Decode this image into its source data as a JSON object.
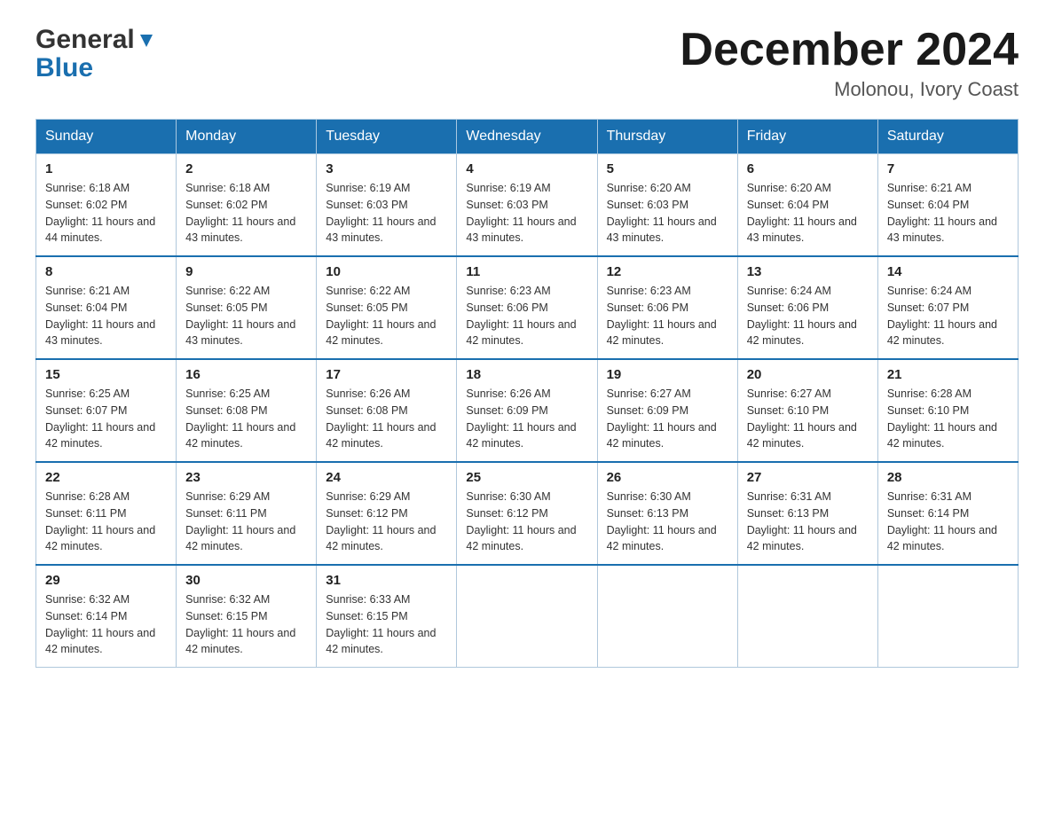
{
  "header": {
    "logo_line1": "General",
    "logo_line2": "Blue",
    "month_year": "December 2024",
    "location": "Molonou, Ivory Coast"
  },
  "days_of_week": [
    "Sunday",
    "Monday",
    "Tuesday",
    "Wednesday",
    "Thursday",
    "Friday",
    "Saturday"
  ],
  "weeks": [
    [
      {
        "day": "1",
        "sunrise": "6:18 AM",
        "sunset": "6:02 PM",
        "daylight": "11 hours and 44 minutes."
      },
      {
        "day": "2",
        "sunrise": "6:18 AM",
        "sunset": "6:02 PM",
        "daylight": "11 hours and 43 minutes."
      },
      {
        "day": "3",
        "sunrise": "6:19 AM",
        "sunset": "6:03 PM",
        "daylight": "11 hours and 43 minutes."
      },
      {
        "day": "4",
        "sunrise": "6:19 AM",
        "sunset": "6:03 PM",
        "daylight": "11 hours and 43 minutes."
      },
      {
        "day": "5",
        "sunrise": "6:20 AM",
        "sunset": "6:03 PM",
        "daylight": "11 hours and 43 minutes."
      },
      {
        "day": "6",
        "sunrise": "6:20 AM",
        "sunset": "6:04 PM",
        "daylight": "11 hours and 43 minutes."
      },
      {
        "day": "7",
        "sunrise": "6:21 AM",
        "sunset": "6:04 PM",
        "daylight": "11 hours and 43 minutes."
      }
    ],
    [
      {
        "day": "8",
        "sunrise": "6:21 AM",
        "sunset": "6:04 PM",
        "daylight": "11 hours and 43 minutes."
      },
      {
        "day": "9",
        "sunrise": "6:22 AM",
        "sunset": "6:05 PM",
        "daylight": "11 hours and 43 minutes."
      },
      {
        "day": "10",
        "sunrise": "6:22 AM",
        "sunset": "6:05 PM",
        "daylight": "11 hours and 42 minutes."
      },
      {
        "day": "11",
        "sunrise": "6:23 AM",
        "sunset": "6:06 PM",
        "daylight": "11 hours and 42 minutes."
      },
      {
        "day": "12",
        "sunrise": "6:23 AM",
        "sunset": "6:06 PM",
        "daylight": "11 hours and 42 minutes."
      },
      {
        "day": "13",
        "sunrise": "6:24 AM",
        "sunset": "6:06 PM",
        "daylight": "11 hours and 42 minutes."
      },
      {
        "day": "14",
        "sunrise": "6:24 AM",
        "sunset": "6:07 PM",
        "daylight": "11 hours and 42 minutes."
      }
    ],
    [
      {
        "day": "15",
        "sunrise": "6:25 AM",
        "sunset": "6:07 PM",
        "daylight": "11 hours and 42 minutes."
      },
      {
        "day": "16",
        "sunrise": "6:25 AM",
        "sunset": "6:08 PM",
        "daylight": "11 hours and 42 minutes."
      },
      {
        "day": "17",
        "sunrise": "6:26 AM",
        "sunset": "6:08 PM",
        "daylight": "11 hours and 42 minutes."
      },
      {
        "day": "18",
        "sunrise": "6:26 AM",
        "sunset": "6:09 PM",
        "daylight": "11 hours and 42 minutes."
      },
      {
        "day": "19",
        "sunrise": "6:27 AM",
        "sunset": "6:09 PM",
        "daylight": "11 hours and 42 minutes."
      },
      {
        "day": "20",
        "sunrise": "6:27 AM",
        "sunset": "6:10 PM",
        "daylight": "11 hours and 42 minutes."
      },
      {
        "day": "21",
        "sunrise": "6:28 AM",
        "sunset": "6:10 PM",
        "daylight": "11 hours and 42 minutes."
      }
    ],
    [
      {
        "day": "22",
        "sunrise": "6:28 AM",
        "sunset": "6:11 PM",
        "daylight": "11 hours and 42 minutes."
      },
      {
        "day": "23",
        "sunrise": "6:29 AM",
        "sunset": "6:11 PM",
        "daylight": "11 hours and 42 minutes."
      },
      {
        "day": "24",
        "sunrise": "6:29 AM",
        "sunset": "6:12 PM",
        "daylight": "11 hours and 42 minutes."
      },
      {
        "day": "25",
        "sunrise": "6:30 AM",
        "sunset": "6:12 PM",
        "daylight": "11 hours and 42 minutes."
      },
      {
        "day": "26",
        "sunrise": "6:30 AM",
        "sunset": "6:13 PM",
        "daylight": "11 hours and 42 minutes."
      },
      {
        "day": "27",
        "sunrise": "6:31 AM",
        "sunset": "6:13 PM",
        "daylight": "11 hours and 42 minutes."
      },
      {
        "day": "28",
        "sunrise": "6:31 AM",
        "sunset": "6:14 PM",
        "daylight": "11 hours and 42 minutes."
      }
    ],
    [
      {
        "day": "29",
        "sunrise": "6:32 AM",
        "sunset": "6:14 PM",
        "daylight": "11 hours and 42 minutes."
      },
      {
        "day": "30",
        "sunrise": "6:32 AM",
        "sunset": "6:15 PM",
        "daylight": "11 hours and 42 minutes."
      },
      {
        "day": "31",
        "sunrise": "6:33 AM",
        "sunset": "6:15 PM",
        "daylight": "11 hours and 42 minutes."
      },
      null,
      null,
      null,
      null
    ]
  ]
}
